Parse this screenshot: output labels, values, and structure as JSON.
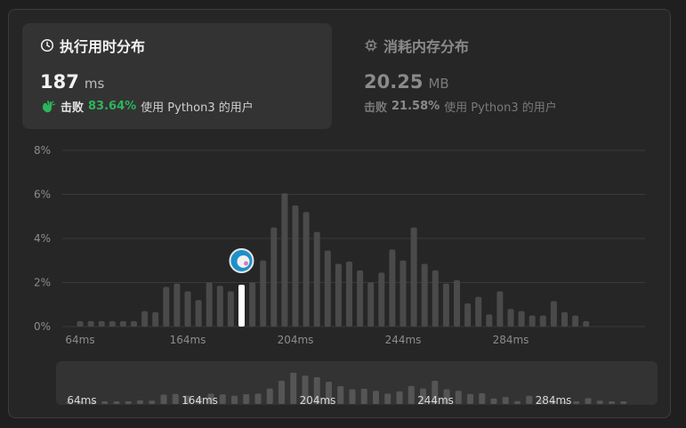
{
  "runtime_card": {
    "title": "执行用时分布",
    "value": "187",
    "unit": "ms",
    "beat_label": "击败",
    "beat_pct": "83.64%",
    "beat_suffix": "使用 Python3 的用户",
    "icon": "clock-icon"
  },
  "memory_card": {
    "title": "消耗内存分布",
    "value": "20.25",
    "unit": "MB",
    "beat_label": "击败",
    "beat_pct": "21.58%",
    "beat_suffix": "使用 Python3 的用户",
    "icon": "chip-icon"
  },
  "colors": {
    "bar": "#4a4a4a",
    "highlight_bar": "#ffffff",
    "grid": "#3a3a3a",
    "tick_text": "#8c8c8c",
    "accent_green": "#2db55d",
    "navigator_bg": "#333333",
    "navigator_bar": "#555555"
  },
  "chart_data": {
    "type": "bar",
    "y_ticks": [
      "8%",
      "6%",
      "4%",
      "2%",
      "0%"
    ],
    "ylim": [
      0,
      8
    ],
    "x_tick_labels": [
      "64ms",
      "164ms",
      "204ms",
      "244ms",
      "284ms"
    ],
    "x_tick_indices": [
      0,
      10,
      20,
      30,
      40
    ],
    "values": [
      0.25,
      0.25,
      0.25,
      0.25,
      0.25,
      0.25,
      0.7,
      0.65,
      1.8,
      1.95,
      1.6,
      1.2,
      2.0,
      1.85,
      1.6,
      1.9,
      2.0,
      3.0,
      4.5,
      6.05,
      5.5,
      5.2,
      4.3,
      3.45,
      2.85,
      2.95,
      2.55,
      2.0,
      2.45,
      3.5,
      3.0,
      4.5,
      2.85,
      2.55,
      1.95,
      2.1,
      1.05,
      1.35,
      0.55,
      1.6,
      0.8,
      0.7,
      0.5,
      0.5,
      1.15,
      0.65,
      0.5,
      0.25
    ],
    "highlight_index": 15,
    "navigator_labels": [
      "64ms",
      "164ms",
      "204ms",
      "244ms",
      "284ms"
    ]
  }
}
